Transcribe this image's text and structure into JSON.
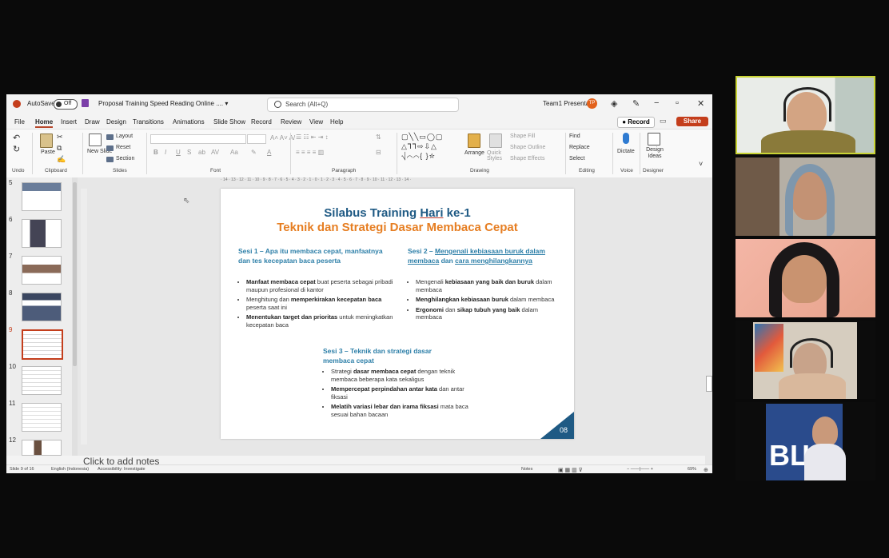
{
  "window": {
    "autosave_label": "AutoSave",
    "autosave_state": "Off",
    "doc_title": "Proposal Training Speed Reading Online .... ▾",
    "search_placeholder": "Search (Alt+Q)",
    "user_name": "Team1 Presenta",
    "user_initials": "TP"
  },
  "menu": [
    "File",
    "Home",
    "Insert",
    "Draw",
    "Design",
    "Transitions",
    "Animations",
    "Slide Show",
    "Record",
    "Review",
    "View",
    "Help"
  ],
  "record_button": "● Record",
  "share_button": "Share",
  "ribbon": {
    "undo_group": "Undo",
    "clipboard_group": "Clipboard",
    "paste_label": "Paste",
    "new_slide_label": "New Slide",
    "layout_label": "Layout",
    "reset_label": "Reset",
    "section_label": "Section",
    "slides_group": "Slides",
    "font_group": "Font",
    "paragraph_group": "Paragraph",
    "arrange_label": "Arrange",
    "quick_styles_label": "Quick Styles",
    "shape_fill_label": "Shape Fill",
    "shape_outline_label": "Shape Outline",
    "shape_effects_label": "Shape Effects",
    "drawing_group": "Drawing",
    "find_label": "Find",
    "replace_label": "Replace",
    "select_label": "Select",
    "editing_group": "Editing",
    "dictate_label": "Dictate",
    "voice_group": "Voice",
    "design_ideas_label": "Design Ideas",
    "designer_group": "Designer"
  },
  "ruler_top": "· 14 · 13 · 12 · 11 · 10 · 9 · 8 · 7 · 6 · 5 · 4 · 3 · 2 · 1 · 0 · 1 · 2 · 3 · 4 · 5 · 6 · 7 · 8 · 9 · 10 · 11 · 12 · 13 · 14 ·",
  "thumbnails": [
    {
      "num": "5"
    },
    {
      "num": "6"
    },
    {
      "num": "7"
    },
    {
      "num": "8"
    },
    {
      "num": "9",
      "selected": true
    },
    {
      "num": "10"
    },
    {
      "num": "11"
    },
    {
      "num": "12"
    }
  ],
  "slide": {
    "title_pre": "Silabus Training ",
    "title_u": "Hari",
    "title_post": " ke-1",
    "subtitle": "Teknik dan Strategi Dasar Membaca Cepat",
    "sesi1": {
      "heading": "Sesi 1 – Apa itu membaca cepat, manfaatnya dan tes kecepatan baca peserta",
      "bullets": [
        [
          "Manfaat membaca cepat",
          " buat peserta sebagai pribadi maupun profesional di kantor"
        ],
        [
          "",
          "Menghitung dan "
        ],
        [
          "Menentukan target dan prioritas",
          " untuk meningkatkan kecepatan baca"
        ]
      ],
      "b2_bold": "memperkirakan kecepatan baca",
      "b2_rest": " peserta saat ini"
    },
    "sesi2": {
      "heading_pre": "Sesi 2 – ",
      "heading_u": "Mengenali kebiasaan buruk dalam membaca",
      "heading_mid": " dan ",
      "heading_u2": "cara menghilangkannya",
      "b1_pre": "Mengenali ",
      "b1_bold": "kebiasaan yang baik dan buruk",
      "b1_post": " dalam membaca",
      "b2_bold": "Menghilangkan kebiasaan buruk",
      "b2_post": " dalam membaca",
      "b3_bold": "Ergonomi",
      "b3_mid": " dan ",
      "b3_bold2": "sikap tubuh yang baik",
      "b3_post": " dalam membaca"
    },
    "sesi3": {
      "heading": "Sesi 3 – Teknik dan strategi dasar membaca cepat",
      "b1_pre": "Strategi ",
      "b1_bold": "dasar membaca cepat",
      "b1_post": " dengan teknik membaca beberapa kata sekaligus",
      "b2_bold": "Mempercepat perpindahan antar kata",
      "b2_post": " dan antar fiksasi",
      "b3_bold": "Melatih variasi lebar dan irama fiksasi",
      "b3_post": " mata baca sesuai bahan bacaan"
    },
    "page_number": "08"
  },
  "notes_placeholder": "Click to add notes",
  "status": {
    "slide_info": "Slide 9 of 16",
    "language": "English (Indonesia)",
    "accessibility": "Accessibility: Investigate",
    "notes": "Notes",
    "zoom": "69%"
  },
  "participants_colors": {
    "p1_bg": "#c9d6d0",
    "p2_bg": "#b9b4ad",
    "p3_bg": "#f0b8a8",
    "p4_bg": "#d9d2c6",
    "p5_bg": "#2f4b89"
  }
}
